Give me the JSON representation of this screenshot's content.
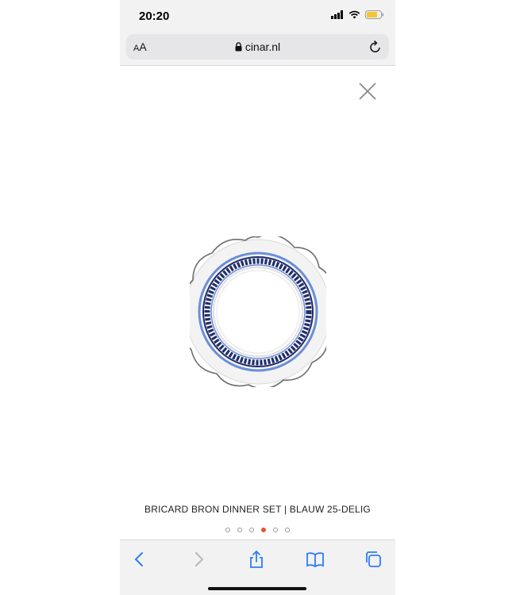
{
  "status_bar": {
    "time": "20:20"
  },
  "browser": {
    "aa_small": "A",
    "aa_large": "A",
    "url": "cinar.nl"
  },
  "product": {
    "caption": "BRICARD BRON DINNER SET | BLAUW 25-DELIG"
  },
  "carousel": {
    "total": 6,
    "active_index": 3
  },
  "colors": {
    "accent": "#e8542c",
    "safari_blue": "#2f7cf6",
    "plate_blue": "#6a8fd8",
    "plate_navy": "#1f2d6b"
  },
  "icons": [
    "signal-icon",
    "wifi-icon",
    "battery-icon",
    "lock-icon",
    "reload-icon",
    "close-icon",
    "back-icon",
    "forward-icon",
    "share-icon",
    "bookmarks-icon",
    "tabs-icon"
  ]
}
